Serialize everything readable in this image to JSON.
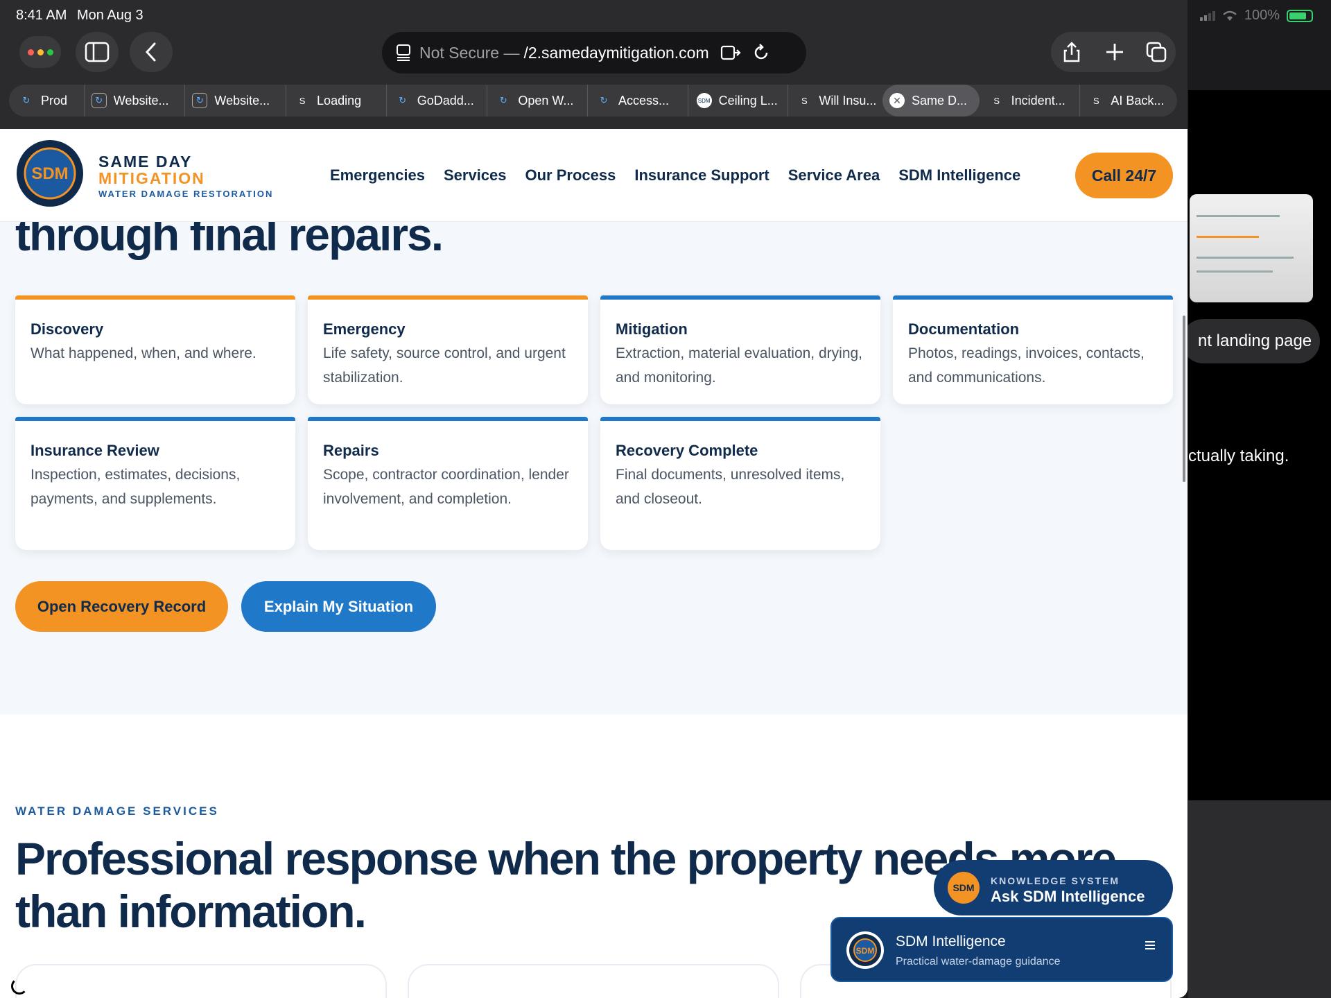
{
  "status_bar": {
    "time": "8:41 AM",
    "date": "Mon Aug 3",
    "battery": "100%"
  },
  "browser": {
    "address": {
      "security": "Not Secure —",
      "domain": "/2.samedaymitigation.com"
    },
    "tabs": [
      {
        "label": "Prod",
        "favicon": "swirl"
      },
      {
        "label": "Website...",
        "favicon": "swirl-boxed"
      },
      {
        "label": "Website...",
        "favicon": "swirl-boxed"
      },
      {
        "label": "Loading",
        "favicon": "S"
      },
      {
        "label": "GoDadd...",
        "favicon": "swirl"
      },
      {
        "label": "Open W...",
        "favicon": "swirl"
      },
      {
        "label": "Access...",
        "favicon": "swirl"
      },
      {
        "label": "Ceiling L...",
        "favicon": "sdm"
      },
      {
        "label": "Will Insu...",
        "favicon": "S"
      },
      {
        "label": "Same D...",
        "favicon": "close",
        "active": true
      },
      {
        "label": "Incident...",
        "favicon": "S"
      },
      {
        "label": "AI Back...",
        "favicon": "S"
      }
    ]
  },
  "side_app": {
    "chip": "nt landing page",
    "text": "ctually taking."
  },
  "site": {
    "brand": {
      "line1": "SAME DAY",
      "line2": "MITIGATION",
      "tagline": "WATER DAMAGE RESTORATION"
    },
    "nav": [
      "Emergencies",
      "Services",
      "Our Process",
      "Insurance Support",
      "Service Area",
      "SDM Intelligence"
    ],
    "call_label": "Call 24/7",
    "hero_tail": "through final repairs.",
    "stages": [
      {
        "title": "Discovery",
        "desc": "What happened, when, and where.",
        "accent": "#f39324"
      },
      {
        "title": "Emergency",
        "desc": "Life safety, source control, and urgent stabilization.",
        "accent": "#f39324"
      },
      {
        "title": "Mitigation",
        "desc": "Extraction, material evaluation, drying, and monitoring.",
        "accent": "#1f78c8"
      },
      {
        "title": "Documentation",
        "desc": "Photos, readings, invoices, contacts, and communications.",
        "accent": "#1f78c8"
      },
      {
        "title": "Insurance Review",
        "desc": "Inspection, estimates, decisions, payments, and supplements.",
        "accent": "#1f78c8"
      },
      {
        "title": "Repairs",
        "desc": "Scope, contractor coordination, lender involvement, and completion.",
        "accent": "#1f78c8"
      },
      {
        "title": "Recovery Complete",
        "desc": "Final documents, unresolved items, and closeout.",
        "accent": "#1f78c8"
      }
    ],
    "cta_primary": "Open Recovery Record",
    "cta_secondary": "Explain My Situation",
    "services_eyebrow": "WATER DAMAGE SERVICES",
    "services_title": "Professional response when the property needs more than information.",
    "ask_widget": {
      "logo_text": "SDM",
      "kicker": "KNOWLEDGE SYSTEM",
      "label": "Ask SDM Intelligence"
    },
    "chat_widget": {
      "title": "SDM Intelligence",
      "subtitle": "Practical water-damage guidance"
    }
  },
  "colors": {
    "navy": "#0f2a4a",
    "orange": "#f39324",
    "blue": "#1f78c8"
  }
}
